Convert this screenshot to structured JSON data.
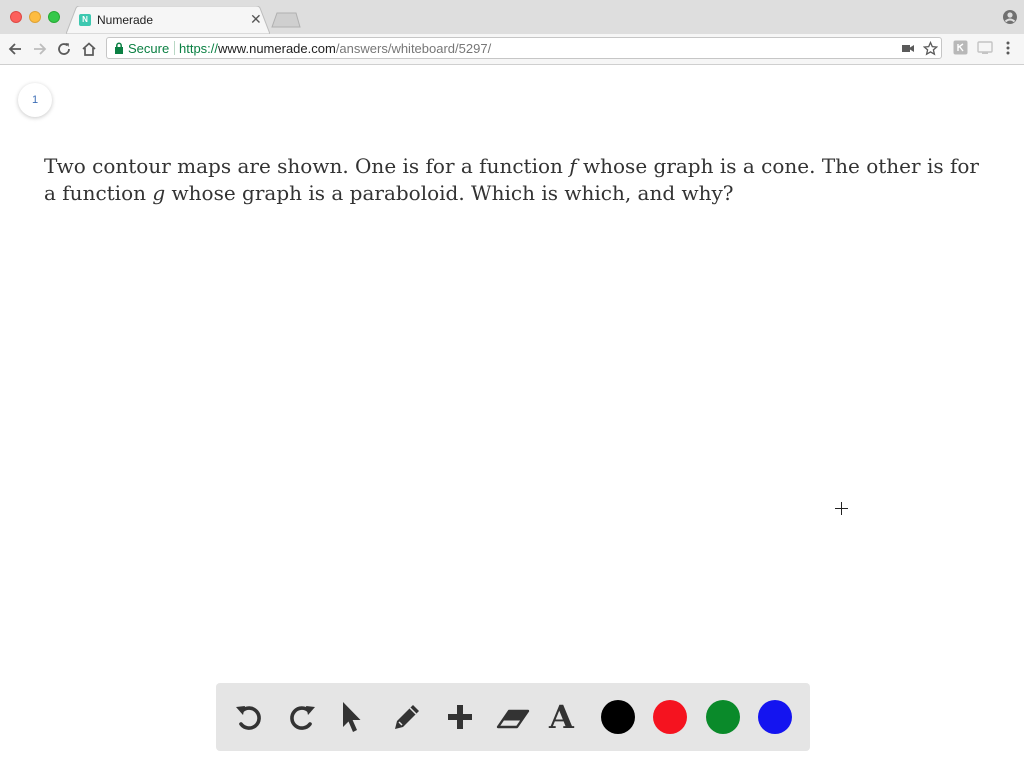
{
  "browser": {
    "tab_title": "Numerade",
    "favicon_letter": "N",
    "secure_label": "Secure",
    "url_scheme": "https://",
    "url_host": "www.numerade.com",
    "url_path": "/answers/whiteboard/5297/"
  },
  "page": {
    "page_number": "1",
    "question_part1": "Two contour maps are shown. One is for a function ",
    "question_var1": "f",
    "question_part2": " whose graph is a cone. The other is for a function ",
    "question_var2": "g",
    "question_part3": " whose graph is a paraboloid. Which is which, and why?"
  },
  "tools": {
    "items": [
      "undo-icon",
      "redo-icon",
      "select-arrow-icon",
      "pencil-icon",
      "add-icon",
      "eraser-icon",
      "text-icon"
    ],
    "text_tool_glyph": "A",
    "colors": [
      "#000000",
      "#f5131f",
      "#0a8a2a",
      "#1414f0"
    ]
  }
}
